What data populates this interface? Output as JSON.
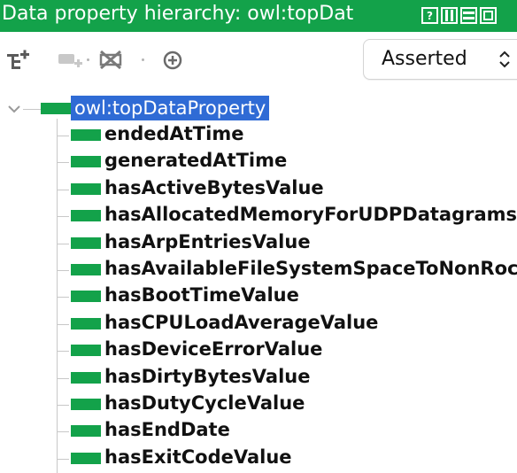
{
  "window": {
    "title": "Data property hierarchy: owl:topDat",
    "controls": [
      "help-icon",
      "split-vertical-icon",
      "split-horizontal-icon",
      "maximize-icon"
    ]
  },
  "toolbar": {
    "icons": [
      "add-subproperty-icon",
      "add-sibling-property-icon",
      "delete-property-icon",
      "find-icon"
    ],
    "view_mode": {
      "selected": "Asserted"
    }
  },
  "tree": {
    "root": {
      "label": "owl:topDataProperty",
      "selected": true,
      "expanded": true
    },
    "children": [
      "endedAtTime",
      "generatedAtTime",
      "hasActiveBytesValue",
      "hasAllocatedMemoryForUDPDatagrams",
      "hasArpEntriesValue",
      "hasAvailableFileSystemSpaceToNonRoc",
      "hasBootTimeValue",
      "hasCPULoadAverageValue",
      "hasDeviceErrorValue",
      "hasDirtyBytesValue",
      "hasDutyCycleValue",
      "hasEndDate",
      "hasExitCodeValue"
    ]
  },
  "colors": {
    "title_bar": "#13a24a",
    "property_swatch": "#13a24a",
    "selection": "#2f6bd5"
  }
}
